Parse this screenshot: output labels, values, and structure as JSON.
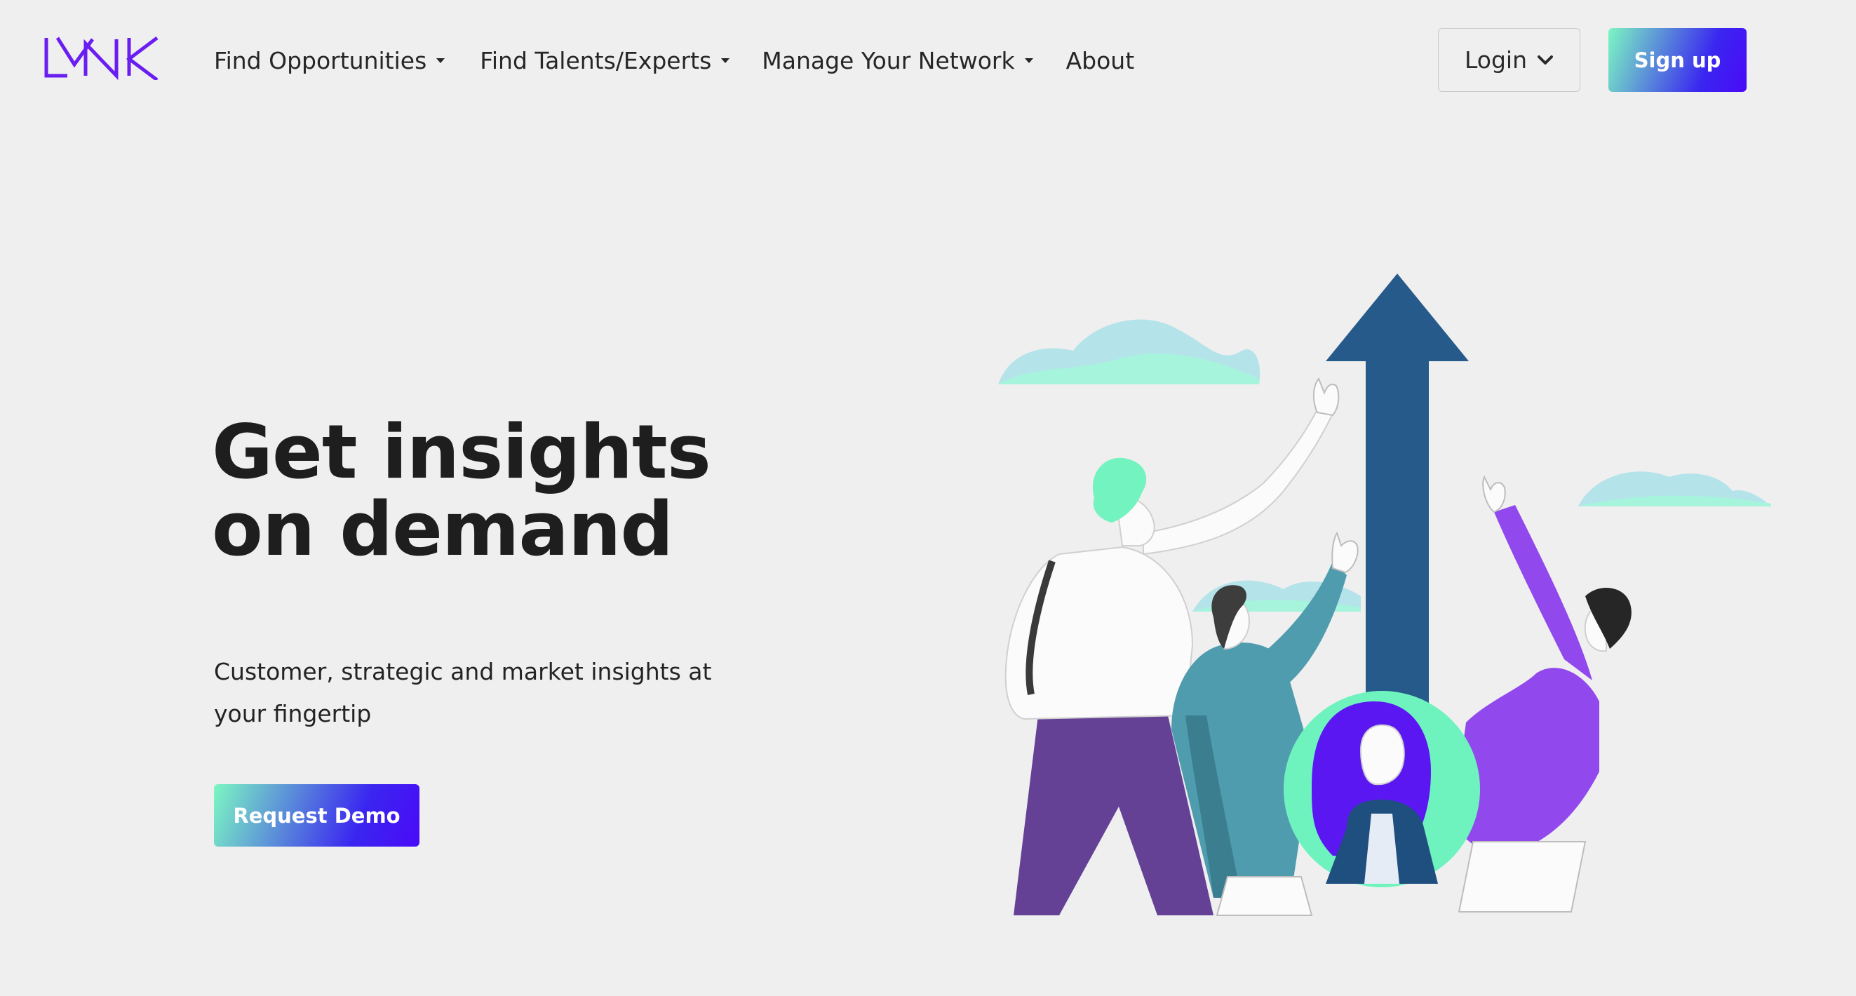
{
  "brand": {
    "logo_alt": "LYNK",
    "logo_color": "#6a1df0"
  },
  "nav": {
    "items": [
      {
        "label": "Find Opportunities",
        "has_dropdown": true
      },
      {
        "label": "Find Talents/Experts",
        "has_dropdown": true
      },
      {
        "label": "Manage Your Network",
        "has_dropdown": true
      },
      {
        "label": "About",
        "has_dropdown": false
      }
    ],
    "login_label": "Login",
    "signup_label": "Sign up"
  },
  "hero": {
    "title": "Get insights on demand",
    "subtitle": "Customer, strategic and market insights at your fingertip",
    "cta_label": "Request Demo"
  },
  "colors": {
    "background": "#efefef",
    "gradient_start": "#7cf6c2",
    "gradient_end": "#4a0af8",
    "arrow": "#265a8b",
    "purple": "#9148ec",
    "teal": "#4f9caf"
  },
  "icons": {
    "dropdown": "chevron-down-icon",
    "nav_caret": "caret-down-icon"
  }
}
